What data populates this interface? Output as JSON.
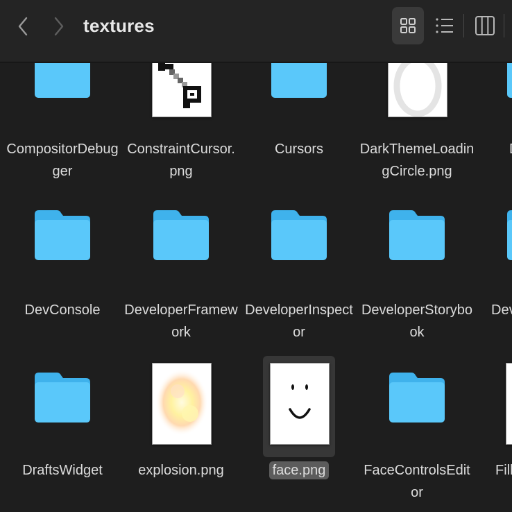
{
  "window": {
    "title": "textures"
  },
  "toolbar": {
    "back_icon": "chevron-left-icon",
    "forward_icon": "chevron-right-icon",
    "views": [
      {
        "name": "icon-view",
        "icon": "grid-icon",
        "active": true
      },
      {
        "name": "list-view",
        "icon": "list-icon",
        "active": false
      },
      {
        "name": "column-view",
        "icon": "columns-icon",
        "active": false
      }
    ]
  },
  "colors": {
    "folder_main": "#5ac8fa",
    "folder_tab": "#3fb2ec",
    "background": "#1e1e1e",
    "selection": "#5c5c5c"
  },
  "items": [
    {
      "label": "CompositorDebug\nger",
      "kind": "folder"
    },
    {
      "label": "ConstraintCursor.\npng",
      "kind": "image",
      "icon": "constraint-cursor-thumbnail"
    },
    {
      "label": "Cursors",
      "kind": "folder"
    },
    {
      "label": "DarkThemeLoadin\ngCircle.png",
      "kind": "image",
      "icon": "loading-circle-thumbnail"
    },
    {
      "label": "D",
      "kind": "folder"
    },
    {
      "label": "DevConsole",
      "kind": "folder"
    },
    {
      "label": "DeveloperFramew\nork",
      "kind": "folder"
    },
    {
      "label": "DeveloperInspect\nor",
      "kind": "folder"
    },
    {
      "label": "DeveloperStorybo\nok",
      "kind": "folder"
    },
    {
      "label": "Dev",
      "kind": "folder"
    },
    {
      "label": "DraftsWidget",
      "kind": "folder"
    },
    {
      "label": "explosion.png",
      "kind": "image",
      "icon": "explosion-thumbnail"
    },
    {
      "label": "face.png",
      "kind": "image",
      "icon": "smiley-face-thumbnail",
      "selected": true
    },
    {
      "label": "FaceControlsEdit\nor",
      "kind": "folder"
    },
    {
      "label": "Fill",
      "kind": "image",
      "icon": "file-thumbnail"
    }
  ]
}
